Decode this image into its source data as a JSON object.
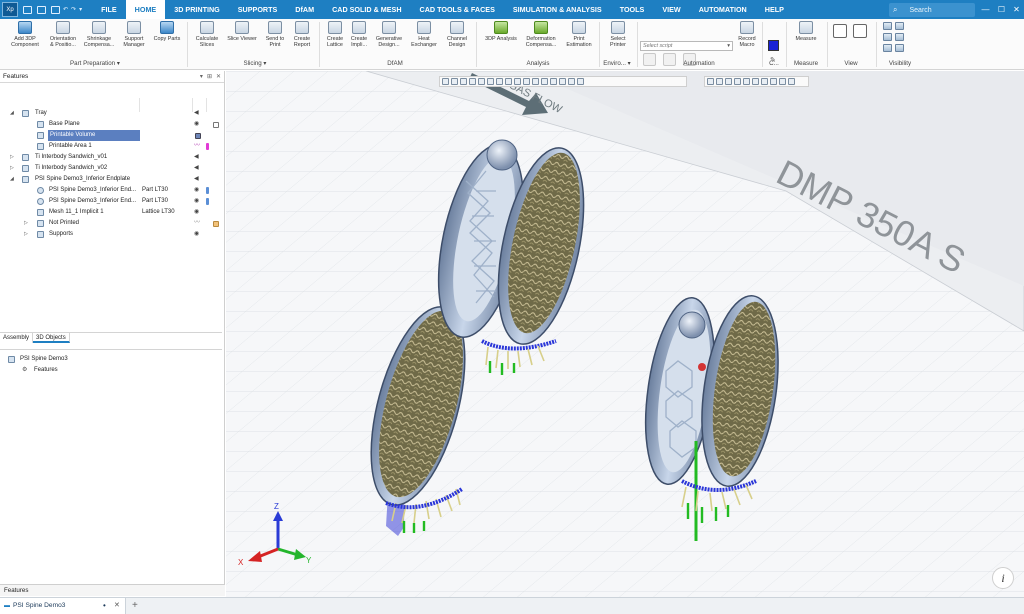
{
  "app": {
    "logo_text": "Xp",
    "menu_tabs": [
      "FILE",
      "HOME",
      "3D PRINTING",
      "SUPPORTS",
      "DfAM",
      "CAD SOLID & MESH",
      "CAD TOOLS & FACES",
      "SIMULATION & ANALYSIS",
      "TOOLS",
      "VIEW",
      "AUTOMATION",
      "HELP"
    ],
    "active_tab": "HOME",
    "search_placeholder": "Search"
  },
  "ribbon": {
    "buttons": [
      {
        "id": "add-3dp",
        "label": "Add 3DP\nComponent"
      },
      {
        "id": "orientation",
        "label": "Orientation\n& Positio..."
      },
      {
        "id": "shrinkage",
        "label": "Shrinkage\nCompensa..."
      },
      {
        "id": "support-manager",
        "label": "Support\nManager"
      },
      {
        "id": "copy-parts",
        "label": "Copy Parts"
      },
      {
        "id": "calculate-slices",
        "label": "Calculate\nSlices"
      },
      {
        "id": "slice-viewer",
        "label": "Slice Viewer"
      },
      {
        "id": "send-to-print",
        "label": "Send to\nPrint"
      },
      {
        "id": "create-report",
        "label": "Create\nReport"
      },
      {
        "id": "create-lattice",
        "label": "Create\nLattice"
      },
      {
        "id": "create-impli",
        "label": "Create\nImpli..."
      },
      {
        "id": "generative-design",
        "label": "Generative\nDesign..."
      },
      {
        "id": "heat-exchanger",
        "label": "Heat\nExchanger"
      },
      {
        "id": "channel-design",
        "label": "Channel\nDesign"
      },
      {
        "id": "3dp-analysis",
        "label": "3DP Analysis"
      },
      {
        "id": "deformation-compensa",
        "label": "Deformation\nCompensa..."
      },
      {
        "id": "print-estimation",
        "label": "Print\nEstimation"
      },
      {
        "id": "select-printer",
        "label": "Select\nPrinter"
      },
      {
        "id": "record-macro",
        "label": "Record\nMacro"
      },
      {
        "id": "measure",
        "label": "Measure"
      }
    ],
    "groups": [
      "Part Preparation",
      "Slicing",
      "DfAM",
      "Analysis",
      "Enviro...",
      "Automation",
      "C...",
      "Measure",
      "View",
      "Visibility"
    ],
    "script_placeholder": "Select script",
    "accent_color": "#1a22d6"
  },
  "features": {
    "title": "Features",
    "rows": [
      {
        "label": "Tray",
        "material": ""
      },
      {
        "label": "Base Plane",
        "material": ""
      },
      {
        "label": "Printable Volume",
        "material": ""
      },
      {
        "label": "Printable Area 1",
        "material": ""
      },
      {
        "label": "Ti Interbody Sandwich_v01",
        "material": ""
      },
      {
        "label": "Ti Interbody Sandwich_v02",
        "material": ""
      },
      {
        "label": "PSI Spine Demo3_Inferior Endplate",
        "material": ""
      },
      {
        "label": "PSI Spine Demo3_Inferior End...",
        "material": "Part LT30"
      },
      {
        "label": "PSI Spine Demo3_Inferior End...",
        "material": "Part LT30"
      },
      {
        "label": "Mesh 11_1 Implicit 1",
        "material": "Lattice LT30"
      },
      {
        "label": "Not Printed",
        "material": ""
      },
      {
        "label": "Supports",
        "material": ""
      }
    ],
    "bottom_tabs": [
      "Assembly",
      "3D Objects"
    ],
    "active_bottom_tab": "3D Objects",
    "lower_tree": [
      "PSI Spine Demo3",
      "Features"
    ],
    "footer": "Features"
  },
  "document": {
    "tab_label": "PSI Spine Demo3"
  },
  "viewport": {
    "tray_label": "DMP 350A S",
    "flow_label": "GAS FLOW",
    "axes": [
      "X",
      "Y",
      "Z"
    ],
    "info_glyph": "i"
  }
}
